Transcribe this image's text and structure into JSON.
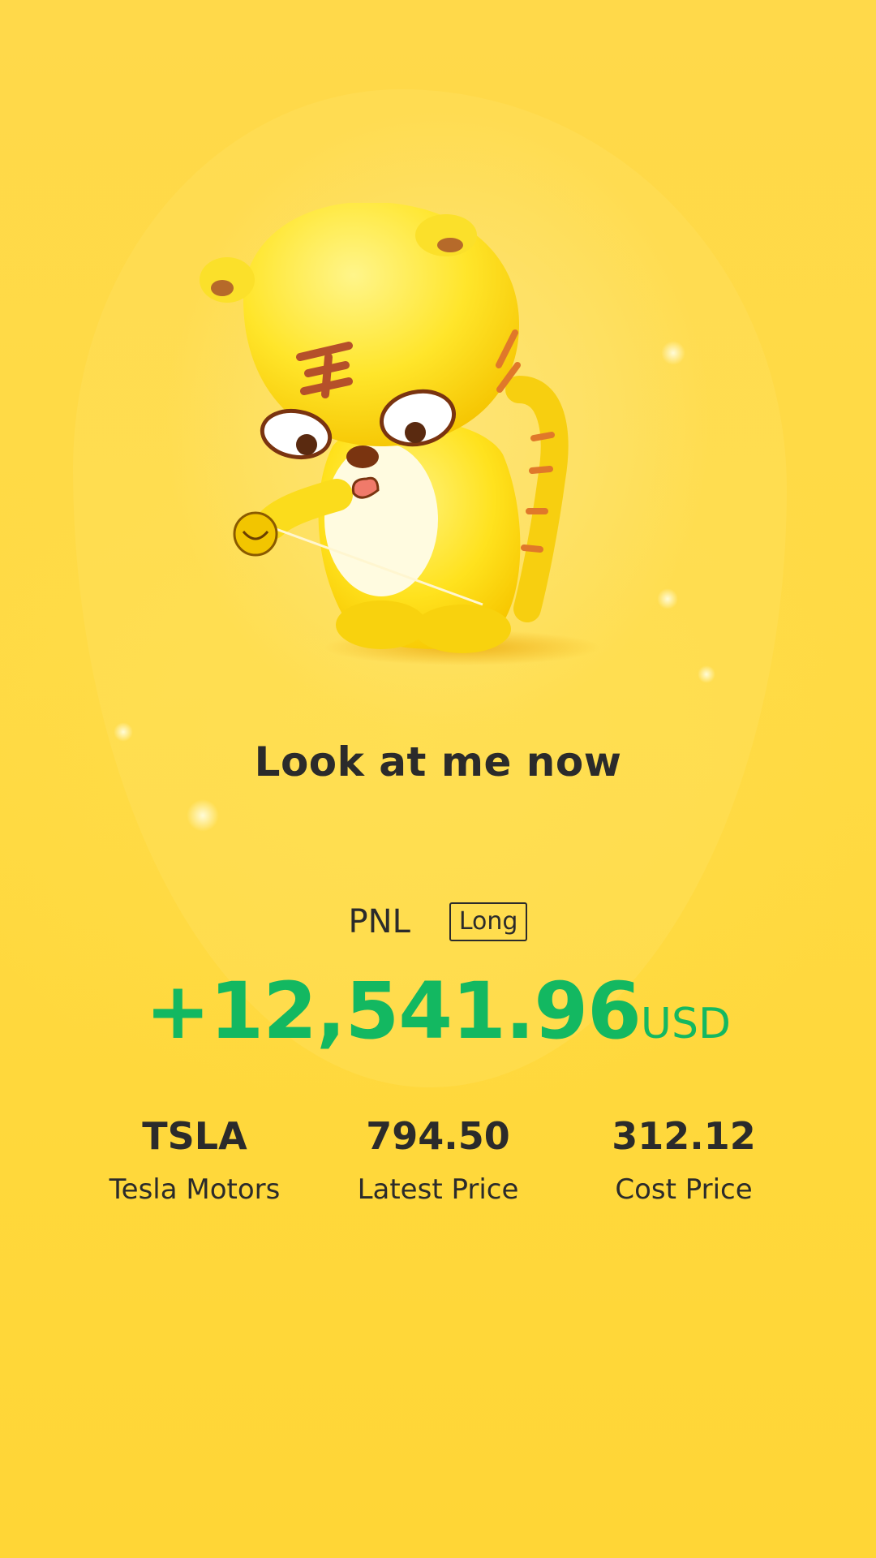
{
  "headline": "Look at me now",
  "pnl": {
    "label": "PNL",
    "position_type": "Long",
    "amount": "+12,541.96",
    "currency": "USD",
    "amount_color": "#13b861"
  },
  "stats": [
    {
      "value": "TSLA",
      "label": "Tesla Motors"
    },
    {
      "value": "794.50",
      "label": "Latest Price"
    },
    {
      "value": "312.12",
      "label": "Cost Price"
    }
  ],
  "mascot": {
    "icon": "tiger-mascot-icon"
  },
  "colors": {
    "background": "#ffd94a",
    "text": "#2b2b2b",
    "profit": "#13b861"
  }
}
